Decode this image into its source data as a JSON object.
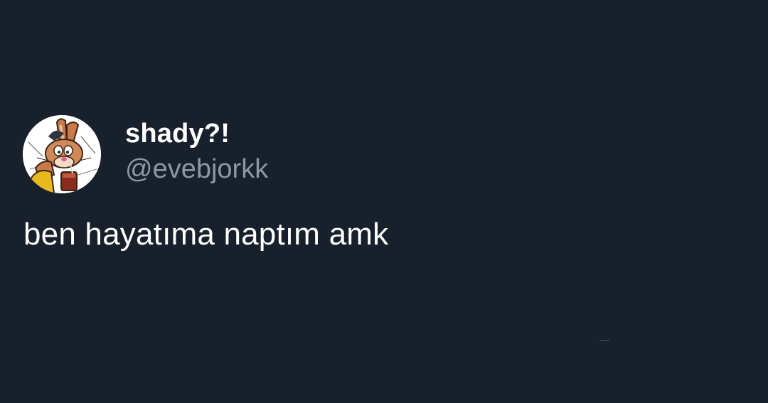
{
  "tweet": {
    "author": {
      "display_name": "shady?!",
      "handle": "@evebjorkk",
      "avatar_icon": "cartoon-rabbit-avatar-icon"
    },
    "text": "ben hayatıma naptım amk"
  },
  "colors": {
    "background": "#18202b",
    "display_name": "#ffffff",
    "handle": "#8b98a5",
    "text": "#ffffff"
  }
}
